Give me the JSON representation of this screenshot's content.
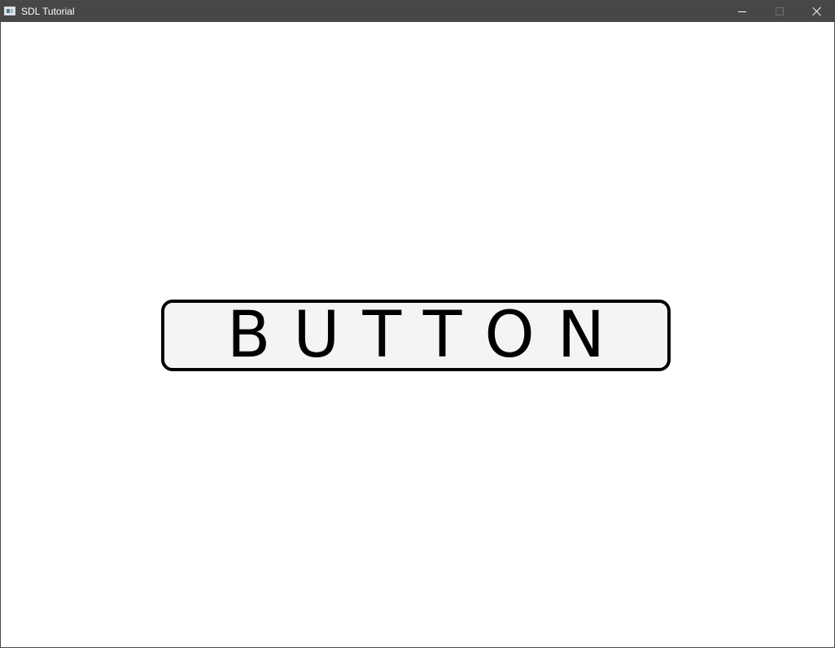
{
  "window": {
    "title": "SDL Tutorial",
    "app_icon": "sdl-window-icon",
    "controls": {
      "minimize_icon": "minimize-icon",
      "maximize_icon": "maximize-icon",
      "close_icon": "close-icon"
    }
  },
  "main": {
    "button_label": "BUTTON"
  },
  "colors": {
    "titlebar": "#474747",
    "background": "#ffffff",
    "button_fill": "#f4f4f4",
    "button_border": "#000000"
  }
}
